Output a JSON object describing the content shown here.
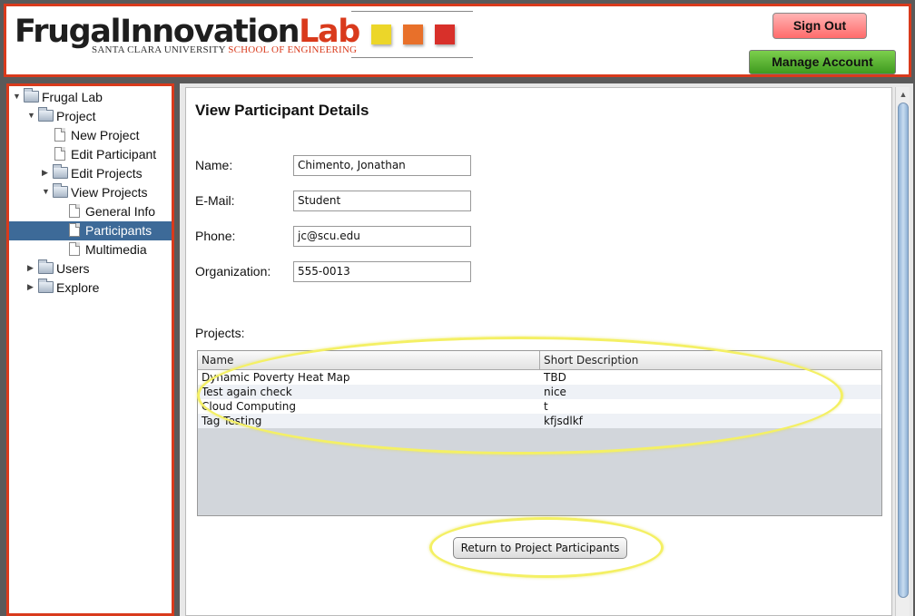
{
  "header": {
    "logo_main": "FrugalInnovation",
    "logo_lab": "Lab",
    "logo_sub_university": "SANTA CLARA UNIVERSITY",
    "logo_sub_school": "SCHOOL OF ENGINEERING",
    "swatch_colors": [
      "#ecd629",
      "#e8702a",
      "#d8302a"
    ],
    "signout_label": "Sign Out",
    "manage_label": "Manage Account"
  },
  "sidebar": {
    "items": [
      {
        "label": "Frugal Lab",
        "type": "folder",
        "expanded": true,
        "depth": 0
      },
      {
        "label": "Project",
        "type": "folder",
        "expanded": true,
        "depth": 1
      },
      {
        "label": "New Project",
        "type": "doc",
        "depth": 2
      },
      {
        "label": "Edit Participant",
        "type": "doc",
        "depth": 2
      },
      {
        "label": "Edit Projects",
        "type": "folder",
        "expanded": false,
        "depth": 2
      },
      {
        "label": "View Projects",
        "type": "folder",
        "expanded": true,
        "depth": 2
      },
      {
        "label": "General Info",
        "type": "doc",
        "depth": 3
      },
      {
        "label": "Participants",
        "type": "doc",
        "depth": 3,
        "selected": true
      },
      {
        "label": "Multimedia",
        "type": "doc",
        "depth": 3
      },
      {
        "label": "Users",
        "type": "folder",
        "expanded": false,
        "depth": 1
      },
      {
        "label": "Explore",
        "type": "folder",
        "expanded": false,
        "depth": 1
      }
    ]
  },
  "main": {
    "title": "View Participant Details",
    "fields": {
      "name_label": "Name:",
      "name_value": "Chimento, Jonathan",
      "email_label": "E-Mail:",
      "email_value": "Student",
      "phone_label": "Phone:",
      "phone_value": "jc@scu.edu",
      "org_label": "Organization:",
      "org_value": "555-0013"
    },
    "projects_label": "Projects:",
    "table": {
      "columns": [
        "Name",
        "Short Description"
      ],
      "rows": [
        {
          "name": "Dynamic Poverty Heat Map",
          "desc": "TBD"
        },
        {
          "name": "Test again check",
          "desc": "nice"
        },
        {
          "name": "Cloud Computing",
          "desc": "t"
        },
        {
          "name": "Tag Testing",
          "desc": "kfjsdlkf"
        }
      ]
    },
    "return_label": "Return to Project Participants"
  },
  "colors": {
    "accent_border": "#d93a1c",
    "selection": "#3d6a98",
    "highlight_ring": "#f4f064"
  }
}
